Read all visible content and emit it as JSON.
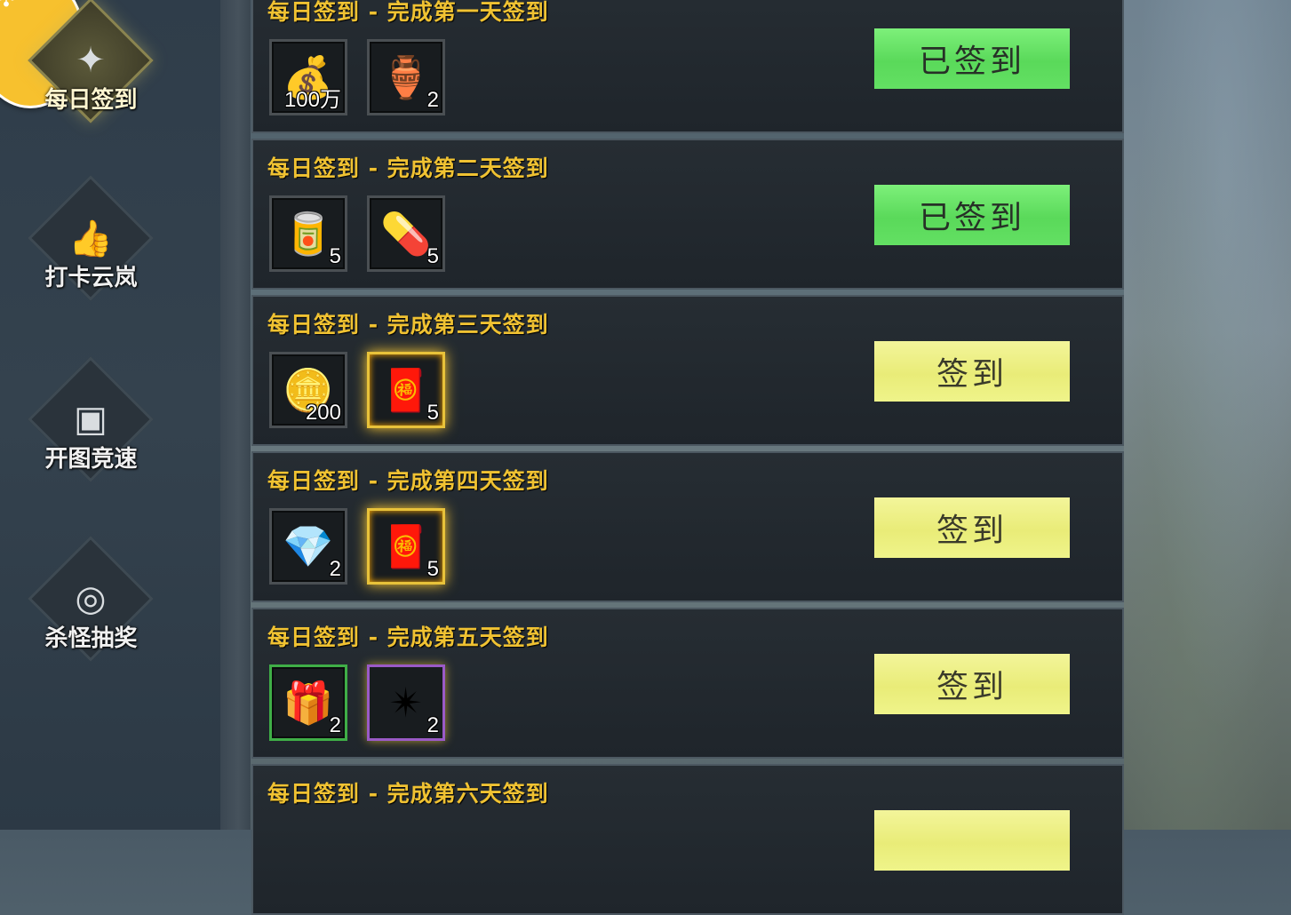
{
  "sidebar": {
    "items": [
      {
        "label": "每日签到",
        "icon": "calendar-icon",
        "active": true
      },
      {
        "label": "打卡云岚",
        "icon": "thumbs-up-icon",
        "active": false
      },
      {
        "label": "开图竞速",
        "icon": "map-image-icon",
        "active": false
      },
      {
        "label": "杀怪抽奖",
        "icon": "scroll-icon",
        "active": false
      }
    ]
  },
  "rows": [
    {
      "title": "每日签到 - 完成第一天签到",
      "button": "已签到",
      "status": "done",
      "items": [
        {
          "icon": "gold-coins-icon",
          "count": "100万"
        },
        {
          "icon": "red-pouch-icon",
          "count": "2"
        }
      ]
    },
    {
      "title": "每日签到 - 完成第二天签到",
      "button": "已签到",
      "status": "done",
      "items": [
        {
          "icon": "canister-icon",
          "count": "5"
        },
        {
          "icon": "pill-capsule-icon",
          "count": "5"
        }
      ]
    },
    {
      "title": "每日签到 - 完成第三天签到",
      "button": "签到",
      "status": "todo",
      "items": [
        {
          "icon": "gold-medal-icon",
          "count": "200"
        },
        {
          "icon": "red-envelope-icon",
          "count": "5"
        }
      ]
    },
    {
      "title": "每日签到 - 完成第四天签到",
      "button": "签到",
      "status": "todo",
      "items": [
        {
          "icon": "gem-crystal-icon",
          "count": "2"
        },
        {
          "icon": "red-envelope-icon",
          "count": "5"
        }
      ]
    },
    {
      "title": "每日签到 - 完成第五天签到",
      "button": "签到",
      "status": "todo",
      "items": [
        {
          "icon": "gift-box-icon",
          "count": "2"
        },
        {
          "icon": "star-shard-icon",
          "count": "2"
        }
      ]
    },
    {
      "title": "每日签到 - 完成第六天签到",
      "button": "",
      "status": "todo",
      "items": []
    }
  ],
  "colors": {
    "title_gold": "#f0c232",
    "button_done": "#5ad95a",
    "button_todo": "#e9ec78",
    "corner_badge": "#f7c12e"
  }
}
